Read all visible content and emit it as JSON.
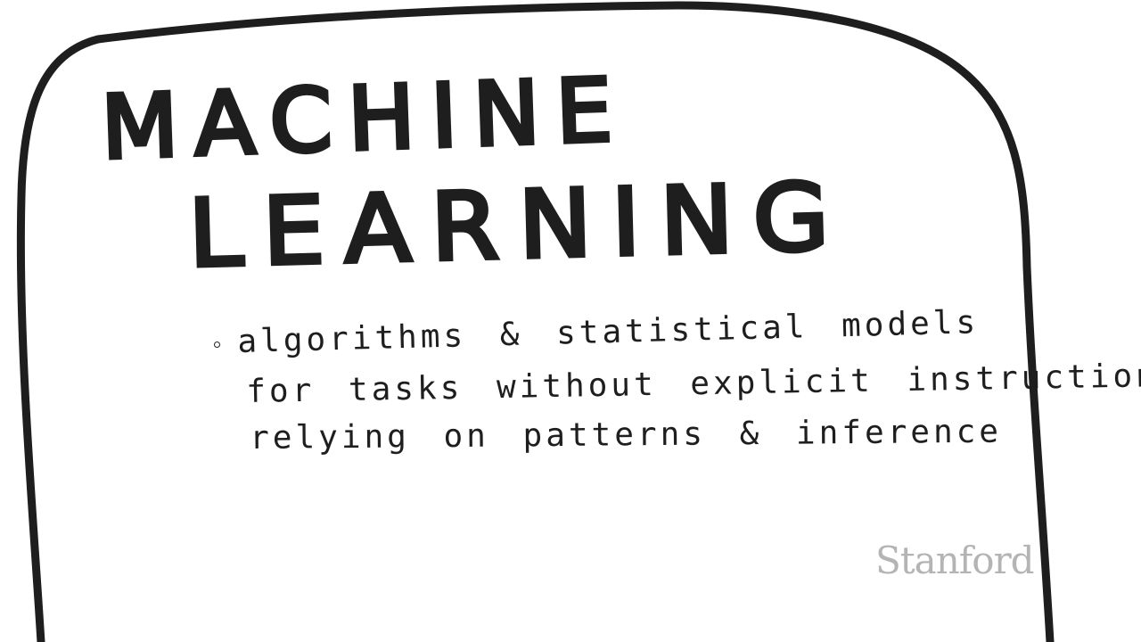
{
  "slide": {
    "title_line_1": "MACHINE",
    "title_line_2": "LEARNING",
    "bullet": {
      "line_1": "algorithms & statistical models",
      "line_2": "for tasks without explicit instructions,",
      "line_3": "relying on patterns & inference"
    }
  },
  "watermark": {
    "text": "Stanford"
  },
  "colors": {
    "ink": "#1e1e1e",
    "watermark": "#b4b4b4",
    "background": "#ffffff"
  }
}
